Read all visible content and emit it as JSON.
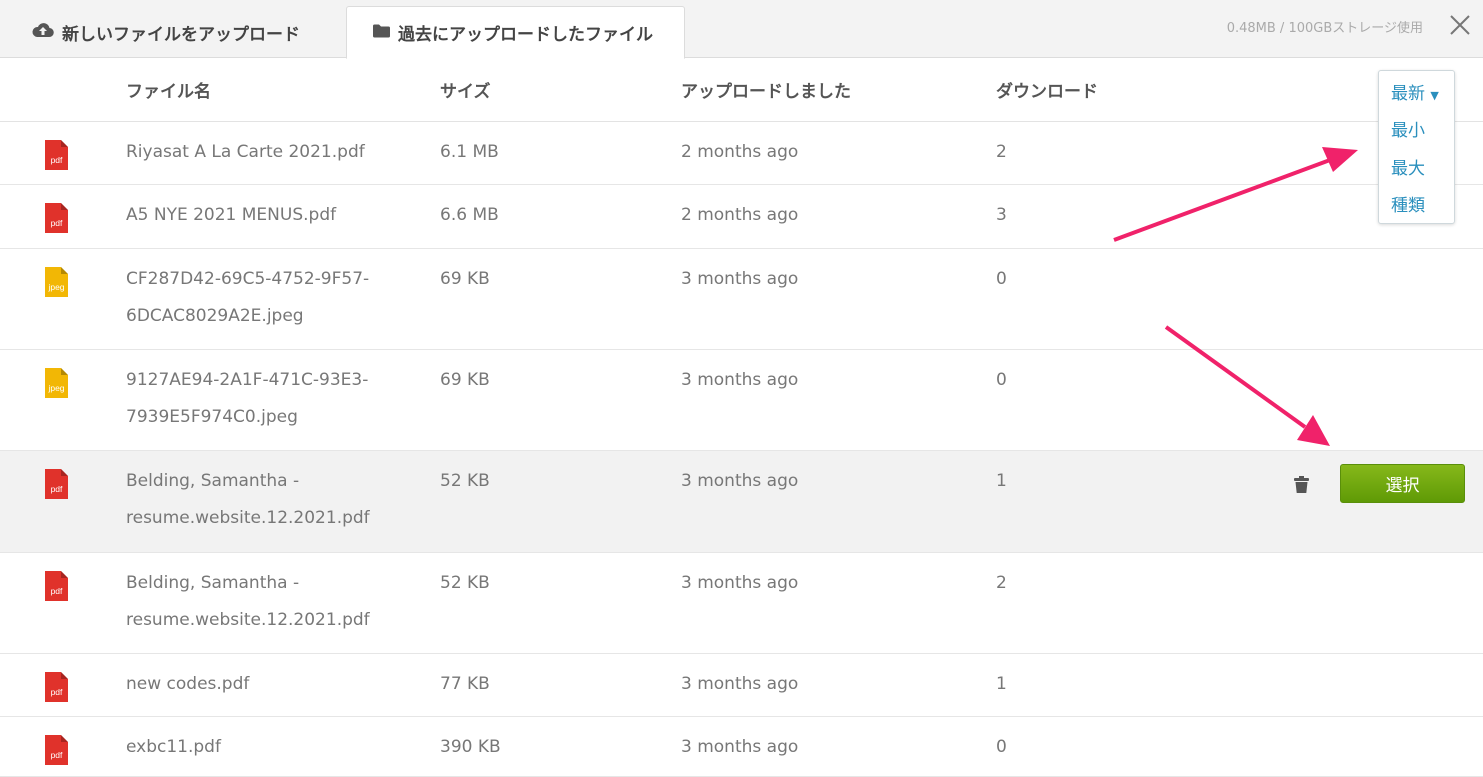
{
  "tabs": {
    "upload_new": "新しいファイルをアップロード",
    "previous": "過去にアップロードしたファイル"
  },
  "storage": "0.48MB / 100GBストレージ使用",
  "headers": {
    "name": "ファイル名",
    "size": "サイズ",
    "uploaded": "アップロードしました",
    "downloads": "ダウンロード"
  },
  "sort": {
    "options": [
      "最新",
      "最小",
      "最大",
      "種類"
    ],
    "selected": "最新"
  },
  "actions": {
    "select_label": "選択"
  },
  "files": [
    {
      "type": "pdf",
      "name1": "Riyasat A La Carte 2021.pdf",
      "name2": "",
      "size": "6.1 MB",
      "uploaded": "2 months ago",
      "downloads": "2"
    },
    {
      "type": "pdf",
      "name1": "A5 NYE 2021 MENUS.pdf",
      "name2": "",
      "size": "6.6 MB",
      "uploaded": "2 months ago",
      "downloads": "3"
    },
    {
      "type": "jpeg",
      "name1": "CF287D42-69C5-4752-9F57-",
      "name2": "6DCAC8029A2E.jpeg",
      "size": "69 KB",
      "uploaded": "3 months ago",
      "downloads": "0"
    },
    {
      "type": "jpeg",
      "name1": "9127AE94-2A1F-471C-93E3-",
      "name2": "7939E5F974C0.jpeg",
      "size": "69 KB",
      "uploaded": "3 months ago",
      "downloads": "0"
    },
    {
      "type": "pdf",
      "name1": "Belding, Samantha -",
      "name2": "resume.website.12.2021.pdf",
      "size": "52 KB",
      "uploaded": "3 months ago",
      "downloads": "1"
    },
    {
      "type": "pdf",
      "name1": "Belding, Samantha -",
      "name2": "resume.website.12.2021.pdf",
      "size": "52 KB",
      "uploaded": "3 months ago",
      "downloads": "2"
    },
    {
      "type": "pdf",
      "name1": "new codes.pdf",
      "name2": "",
      "size": "77 KB",
      "uploaded": "3 months ago",
      "downloads": "1"
    },
    {
      "type": "pdf",
      "name1": "exbc11.pdf",
      "name2": "",
      "size": "390 KB",
      "uploaded": "3 months ago",
      "downloads": "0"
    }
  ],
  "colors": {
    "pdf": "#e0322b",
    "jpeg": "#f2b705",
    "accent": "#2a8fbd",
    "select": "#6aa60d",
    "arrow": "#f0226a"
  }
}
